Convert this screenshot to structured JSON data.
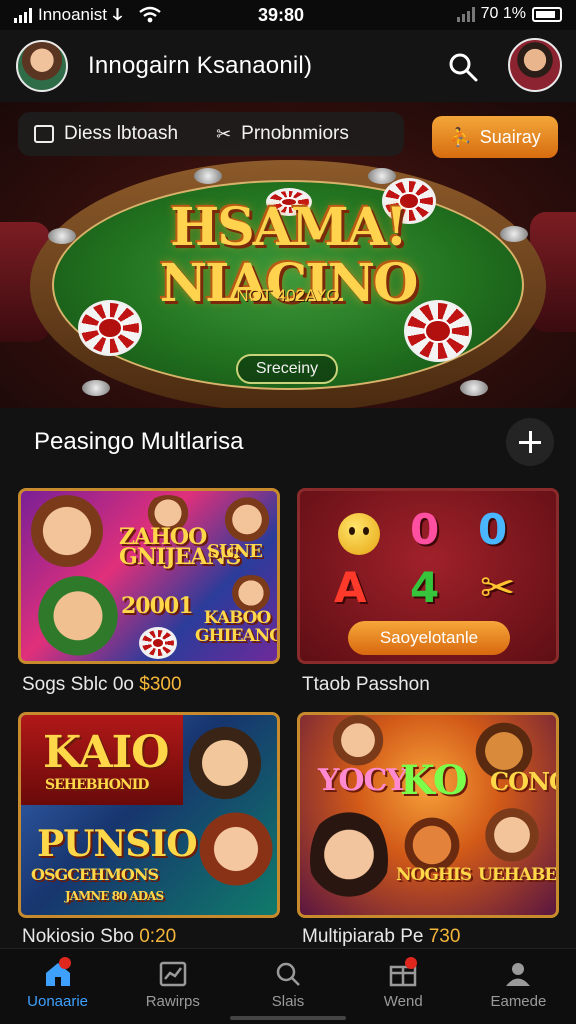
{
  "status_bar": {
    "carrier": "Innoanist",
    "time": "39:80",
    "battery_text": "70 1%"
  },
  "header": {
    "title": "Innogairn  Ksanaonil)"
  },
  "hero": {
    "pill_left_label": "Diess lbtoash",
    "pill_right_label": "Prnobnmiors",
    "signup_label": "Suairay",
    "title": "HSAMA! NIACINO",
    "subtitle": "NOT 402AYO",
    "button_label": "Sreceiny"
  },
  "section": {
    "title": "Peasingo Multlarisa"
  },
  "cards": [
    {
      "caption": "Sogs Sblc 0o",
      "value": "$300",
      "art_text_1": "ZAHOO GNIJEANS",
      "art_text_2": "SUNE",
      "art_text_3": "20001",
      "art_text_4": "KABOO GHIEANO"
    },
    {
      "caption": "Ttaob Passhon",
      "button": "Saoyelotanle",
      "symbols": [
        "A",
        "4",
        "0"
      ]
    },
    {
      "caption": "Nokiosio Sbo",
      "value": "0:20",
      "art_text_1": "KAIO",
      "art_text_2": "SEHEBHONID",
      "art_text_3": "PUNSIO",
      "art_text_4": "OSGCEHMONS",
      "art_text_5": "JAMNE 80 ADAS"
    },
    {
      "caption": "Multipiarab Pe",
      "value": "730",
      "art_text_1": "YOCY",
      "art_text_2": "KO",
      "art_text_3": "CONG",
      "art_text_4": "NOGHIS",
      "art_text_5": "UEHABE"
    }
  ],
  "bottom_nav": [
    {
      "label": "Uonaarie",
      "active": true,
      "icon": "home-icon"
    },
    {
      "label": "Rawirps",
      "active": false,
      "icon": "chart-icon"
    },
    {
      "label": "Slais",
      "active": false,
      "icon": "search-icon"
    },
    {
      "label": "Wend",
      "active": false,
      "icon": "gift-icon"
    },
    {
      "label": "Eamede",
      "active": false,
      "icon": "profile-icon"
    }
  ],
  "colors": {
    "accent_orange": "#e58a23",
    "active_blue": "#3ea0ff",
    "background": "#121212"
  }
}
